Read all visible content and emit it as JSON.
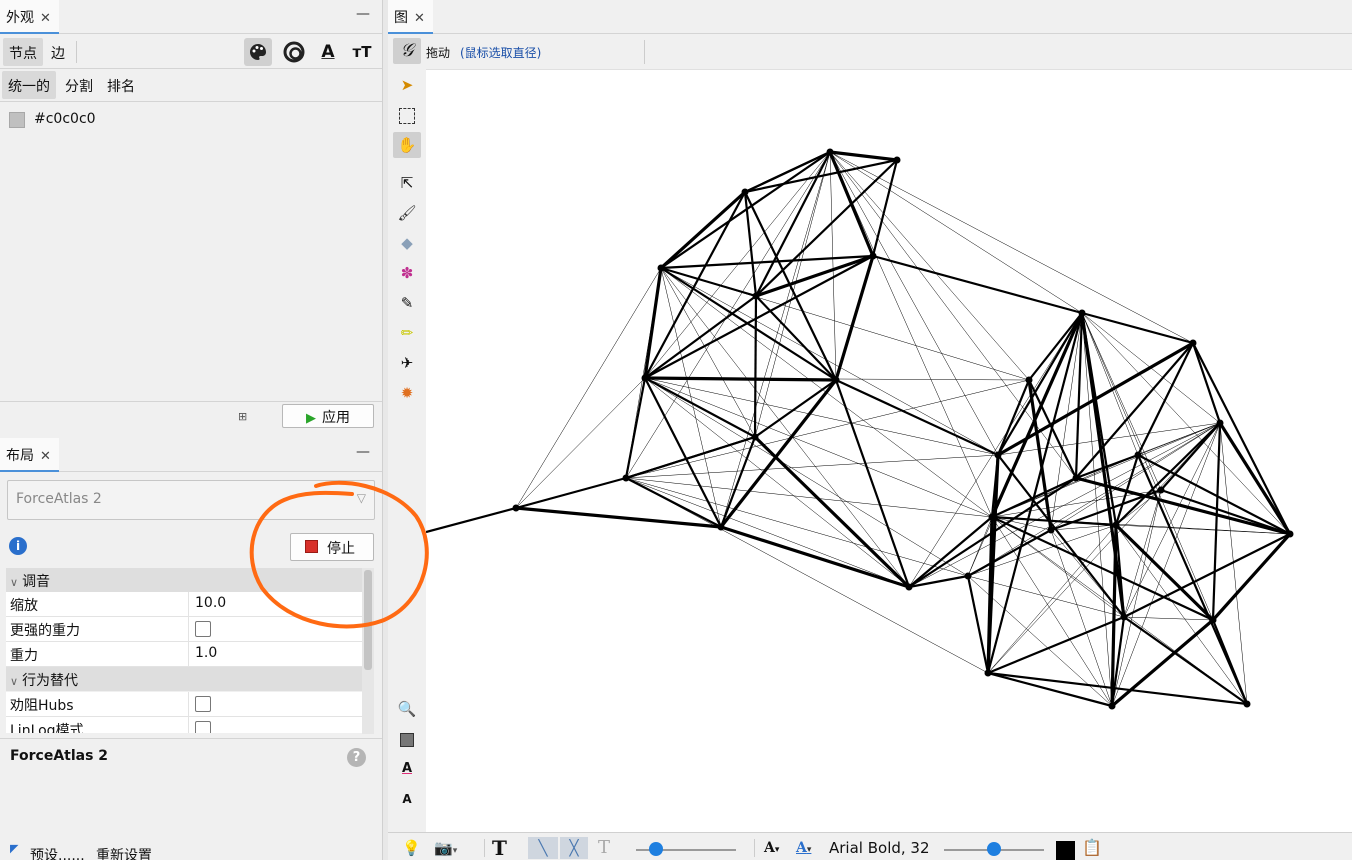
{
  "appearance": {
    "tab_title": "外观",
    "close": "✕",
    "minimize": "—",
    "element_tabs": [
      "节点",
      "边"
    ],
    "mode_tabs": [
      "统一的",
      "分割",
      "排名"
    ],
    "color_value": "#c0c0c0",
    "apply_label": "应用"
  },
  "layout": {
    "tab_title": "布局",
    "close": "✕",
    "minimize": "—",
    "algorithm": "ForceAtlas 2",
    "stop_label": "停止",
    "sections": {
      "tuning": "调音",
      "behavior": "行为替代"
    },
    "props": {
      "scaling": {
        "label": "缩放",
        "value": "10.0"
      },
      "stronger_gravity": {
        "label": "更强的重力",
        "checked": false
      },
      "gravity": {
        "label": "重力",
        "value": "1.0"
      },
      "dissuade_hubs": {
        "label": "劝阻Hubs",
        "checked": false
      },
      "linlog": {
        "label": "LinLog模式",
        "checked": false
      }
    },
    "description_title": "ForceAtlas 2",
    "presets_label": "预设......",
    "reset_label": "重新设置"
  },
  "graph": {
    "tab_title": "图",
    "close": "✕",
    "mode_label": "拖动",
    "mode_hint": "(鼠标选取直径)"
  },
  "bottom": {
    "font_label": "Arial Bold, 32",
    "node_slider_level": 0.2,
    "label_slider_level": 0.5
  },
  "colors": {
    "highlight_circle": "#ff6a13",
    "accent": "#1e7fe0",
    "node_color": "#c0c0c0"
  }
}
